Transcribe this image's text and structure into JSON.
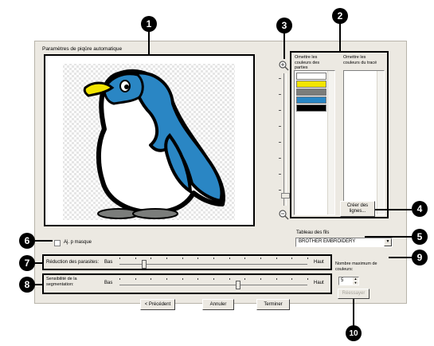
{
  "dialog": {
    "title": "Paramètres de piqûre automatique"
  },
  "callouts": [
    "1",
    "2",
    "3",
    "4",
    "5",
    "6",
    "7",
    "8",
    "9",
    "10"
  ],
  "thread_lists": {
    "omit_pattern_header": "Omettre les couleurs des parties",
    "omit_outline_header": "Omettre les couleurs du tracé",
    "pattern_colors": [
      "#ffffff",
      "#f2e400",
      "#7b7d7b",
      "#2a86c4",
      "#000000"
    ]
  },
  "create_lines_button": "Créer des lignes...",
  "thread_chart": {
    "label": "Tableau des fils",
    "selected": "BROTHER EMBROIDERY"
  },
  "mask_checkbox": {
    "label": "Aj. p masque",
    "checked": false
  },
  "noise_reduction": {
    "label": "Réduction des parasites:",
    "low": "Bas",
    "high": "Haut",
    "level": 0.12
  },
  "segmentation": {
    "label": "Sensibilité de la segmentation:",
    "low": "Bas",
    "high": "Haut",
    "level": 0.63
  },
  "max_colors": {
    "label": "Nombre maximum de couleurs:",
    "value": "5"
  },
  "retry_button": "Réessayer",
  "nav": {
    "back": "< Précédent",
    "cancel": "Annuler",
    "finish": "Terminer"
  },
  "icons": [
    "zoom-in-icon",
    "zoom-out-icon",
    "spin-up-icon",
    "spin-down-icon",
    "dropdown-arrow-icon"
  ],
  "colors": {
    "penguin_blue": "#2a86c4",
    "penguin_beak": "#f2e400",
    "feet_gray": "#7b7d7b"
  }
}
